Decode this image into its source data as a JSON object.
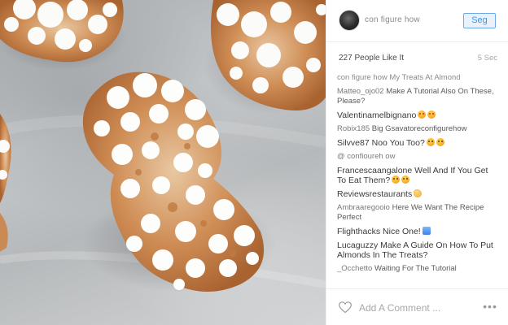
{
  "post": {
    "username": "con figure how",
    "follow_label": "Seg",
    "likes_text": "227 People Like It",
    "time_ago": "5 Sec",
    "comment_placeholder": "Add A Comment ...",
    "more_label": "•••"
  },
  "photo": {
    "description_icon": "crinkle-cookies-photo"
  },
  "comments": [
    {
      "user": "con figure how",
      "text": " My Treats At Almond",
      "style": "caption"
    },
    {
      "user": "Matteo_ojo02",
      "text": " Make A Tutorial Also On These, Please?",
      "style": "small"
    },
    {
      "user": "Valentinamelbignano",
      "text": "",
      "emoji": [
        "heart",
        "heart"
      ],
      "style": "big"
    },
    {
      "user": "Robix185",
      "text": " Big Gsavatoreconfigurehow",
      "style": "small"
    },
    {
      "user": "Silvve87",
      "text": " Noo You Too?",
      "emoji": [
        "sad",
        "sad"
      ],
      "style": "big"
    },
    {
      "user": "@ confioureh ow",
      "text": "",
      "style": "small"
    },
    {
      "user": "Francescaangalone",
      "text": " Well And If You Get To Eat Them?",
      "emoji": [
        "sad",
        "sad"
      ],
      "style": "big"
    },
    {
      "user": "Reviewsrestaurants",
      "text": "",
      "emoji": [
        "hand"
      ],
      "style": "big"
    },
    {
      "user": "Ambraaregooio",
      "text": " Here We Want The Recipe Perfect",
      "style": "small"
    },
    {
      "user": "Flighthacks",
      "text": " Nice One!",
      "emoji": [
        "face-blue"
      ],
      "style": "big"
    },
    {
      "user": "Lucaguzzy",
      "text": " Make A Guide On How To Put Almonds In The Treats?",
      "style": "big"
    },
    {
      "user": "_Occhetto",
      "text": " Waiting For The Tutorial",
      "style": "small"
    }
  ],
  "colors": {
    "accent": "#3897f0",
    "divider": "#efefef",
    "text_primary": "#262626",
    "text_muted": "#a8a8a8"
  }
}
